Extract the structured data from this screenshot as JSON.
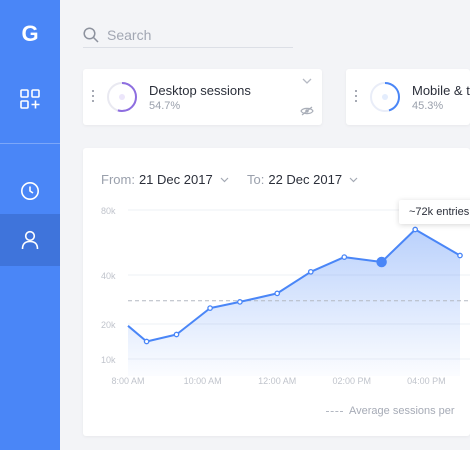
{
  "sidebar": {
    "logo": "G",
    "items": [
      {
        "icon": "apps-add-icon"
      },
      {
        "icon": "clock-icon"
      },
      {
        "icon": "user-icon",
        "active": true
      }
    ],
    "colors": {
      "bg": "#4a86f7",
      "active": "#3f74db"
    }
  },
  "search": {
    "placeholder": "Search",
    "value": ""
  },
  "cards": [
    {
      "title": "Desktop sessions",
      "value": "54.7%",
      "ring_color": "#8e6ee0"
    },
    {
      "title": "Mobile & t",
      "value": "45.3%",
      "ring_color": "#4a86f7"
    }
  ],
  "filters": {
    "from_label": "From:",
    "from_value": "21 Dec 2017",
    "to_label": "To:",
    "to_value": "22 Dec 2017"
  },
  "tooltip": "~72k entries",
  "legend": "Average sessions per",
  "chart_data": {
    "type": "area",
    "title": "",
    "xlabel": "",
    "ylabel": "",
    "y_ticks": [
      {
        "label": "80k",
        "value": 80
      },
      {
        "label": "40k",
        "value": 40
      },
      {
        "label": "20k",
        "value": 20
      },
      {
        "label": "10k",
        "value": 10
      }
    ],
    "x_ticks": [
      "8:00 AM",
      "10:00 AM",
      "12:00 AM",
      "02:00 PM",
      "04:00 PM"
    ],
    "x_tick_positions": [
      0,
      2,
      4,
      6,
      8
    ],
    "x": [
      0,
      0.5,
      1.3,
      2.2,
      3.0,
      4.0,
      4.9,
      5.8,
      6.8,
      7.7,
      8.9
    ],
    "values": [
      19.5,
      15,
      17,
      26.5,
      29,
      32.5,
      42,
      51,
      48,
      68,
      52
    ],
    "highlight_index": 8,
    "average": 29.5,
    "color": "#4a86f7"
  }
}
